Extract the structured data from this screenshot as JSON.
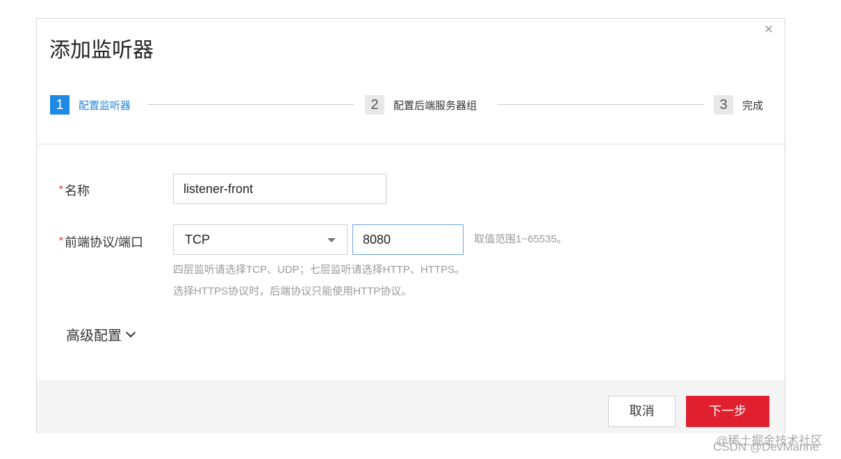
{
  "dialog": {
    "title": "添加监听器",
    "close_glyph": "×"
  },
  "steps": [
    {
      "number": "1",
      "label": "配置监听器",
      "active": true
    },
    {
      "number": "2",
      "label": "配置后端服务器组",
      "active": false
    },
    {
      "number": "3",
      "label": "完成",
      "active": false
    }
  ],
  "form": {
    "required_mark": "*",
    "name": {
      "label": "名称",
      "value": "listener-front"
    },
    "protocol_port": {
      "label": "前端协议/端口",
      "protocol_value": "TCP",
      "port_value": "8080",
      "range_hint": "取值范围1~65535。",
      "help_line1": "四层监听请选择TCP、UDP；七层监听请选择HTTP、HTTPS。",
      "help_line2": "选择HTTPS协议时，后端协议只能使用HTTP协议。"
    },
    "advanced_label": "高级配置"
  },
  "footer": {
    "cancel_label": "取消",
    "next_label": "下一步"
  },
  "watermark": {
    "line1": "@稀土掘金技术社区",
    "line2": "CSDN @DevMarine"
  },
  "colors": {
    "accent": "#1e88e5",
    "primary_button": "#e0202e",
    "required": "#e0312a"
  },
  "icons": {
    "close": "close-icon",
    "select_caret": "caret-down-icon",
    "advanced_toggle": "chevron-down-icon"
  }
}
